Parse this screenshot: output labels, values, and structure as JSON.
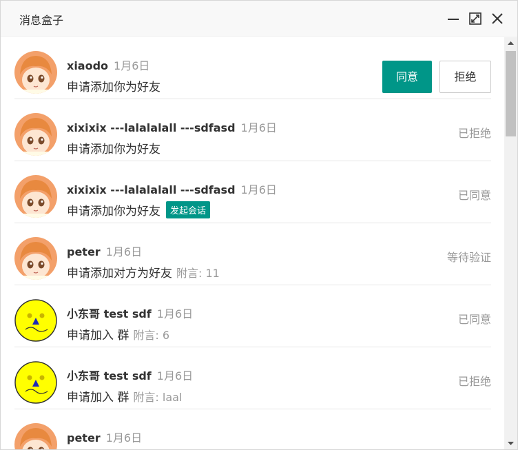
{
  "window": {
    "title": "消息盒子"
  },
  "actions": {
    "agree_label": "同意",
    "reject_label": "拒绝"
  },
  "messages": [
    {
      "name": "xiaodo",
      "date": "1月6日",
      "text": "申请添加你为好友",
      "remark": "",
      "badge": "",
      "status": "",
      "avatar": "girl-avatar"
    },
    {
      "name": "xixixix ---lalalalall ---sdfasd",
      "date": "1月6日",
      "text": "申请添加你为好友",
      "remark": "",
      "badge": "",
      "status": "已拒绝",
      "avatar": "girl-avatar"
    },
    {
      "name": "xixixix ---lalalalall ---sdfasd",
      "date": "1月6日",
      "text": "申请添加你为好友",
      "remark": "",
      "badge": "发起会话",
      "status": "已同意",
      "avatar": "girl-avatar"
    },
    {
      "name": "peter",
      "date": "1月6日",
      "text": "申请添加对方为好友",
      "remark": "附言: 11",
      "badge": "",
      "status": "等待验证",
      "avatar": "girl-avatar"
    },
    {
      "name": "小东哥 test sdf",
      "date": "1月6日",
      "text": "申请加入 群",
      "remark": "附言: 6",
      "badge": "",
      "status": "已同意",
      "avatar": "smiley-avatar"
    },
    {
      "name": "小东哥 test sdf",
      "date": "1月6日",
      "text": "申请加入 群",
      "remark": "附言: laal",
      "badge": "",
      "status": "已拒绝",
      "avatar": "smiley-avatar"
    },
    {
      "name": "peter",
      "date": "1月6日",
      "text": "",
      "remark": "",
      "badge": "",
      "status": "",
      "avatar": "girl-avatar"
    }
  ],
  "colors": {
    "accent": "#009688",
    "muted_text": "#999999",
    "titlebar_bg": "#f8f8f8"
  }
}
